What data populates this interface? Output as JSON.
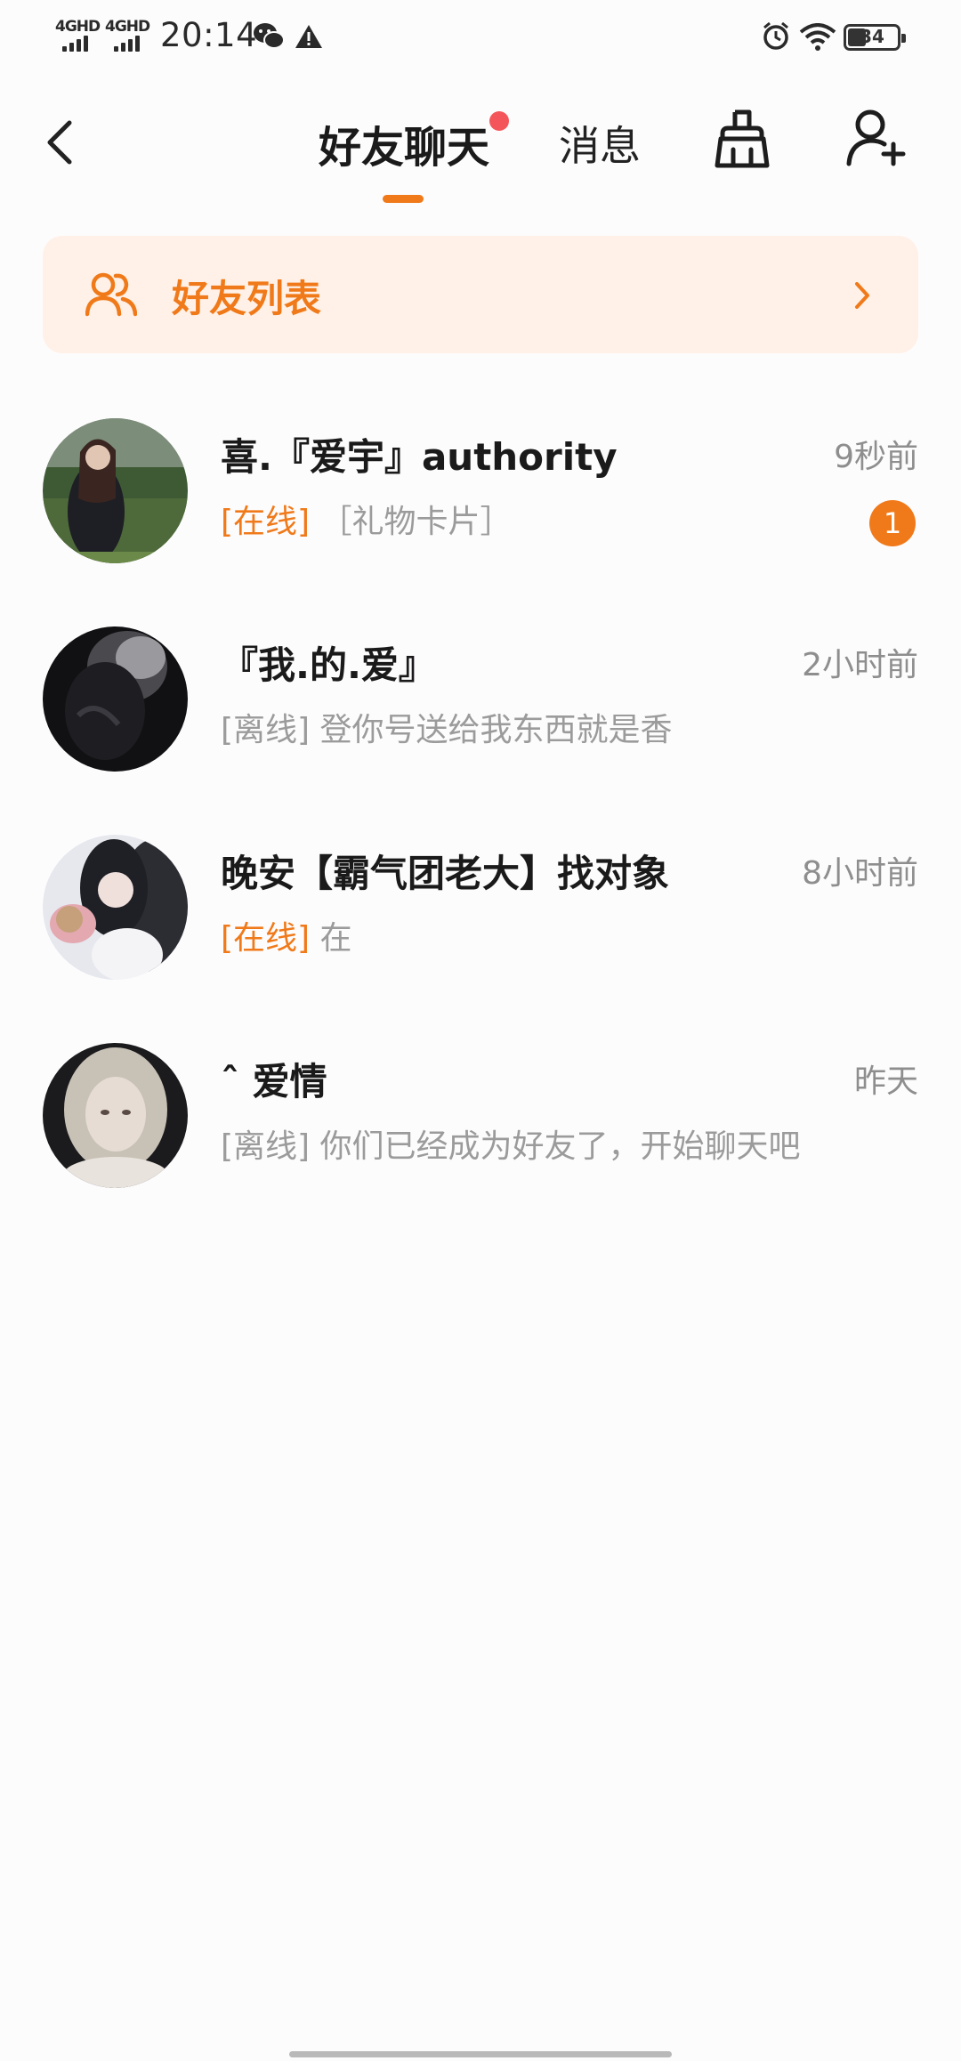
{
  "status_bar": {
    "network1": "4GHD",
    "network2": "4GHD",
    "time": "20:14",
    "battery": "34"
  },
  "header": {
    "tab_friends": "好友聊天",
    "tab_messages": "消息"
  },
  "friend_list_banner": {
    "label": "好友列表"
  },
  "chats": [
    {
      "name": "喜.『爱宇』authority",
      "time": "9秒前",
      "status": "[在线]",
      "preview": "［礼物卡片］",
      "unread": "1"
    },
    {
      "name": "『我.的.爱』",
      "time": "2小时前",
      "status": "[离线]",
      "preview": "登你号送给我东西就是香"
    },
    {
      "name": "晚安【霸气团老大】找对象",
      "time": "8小时前",
      "status": "[在线]",
      "preview": "在"
    },
    {
      "name": "ˆ 爱情",
      "time": "昨天",
      "status": "[离线]",
      "preview": "你们已经成为好友了，开始聊天吧"
    }
  ],
  "colors": {
    "accent": "#f07a1a",
    "banner_bg": "#fff1e8",
    "dot": "#f4555a",
    "muted": "#9b9b9b"
  }
}
